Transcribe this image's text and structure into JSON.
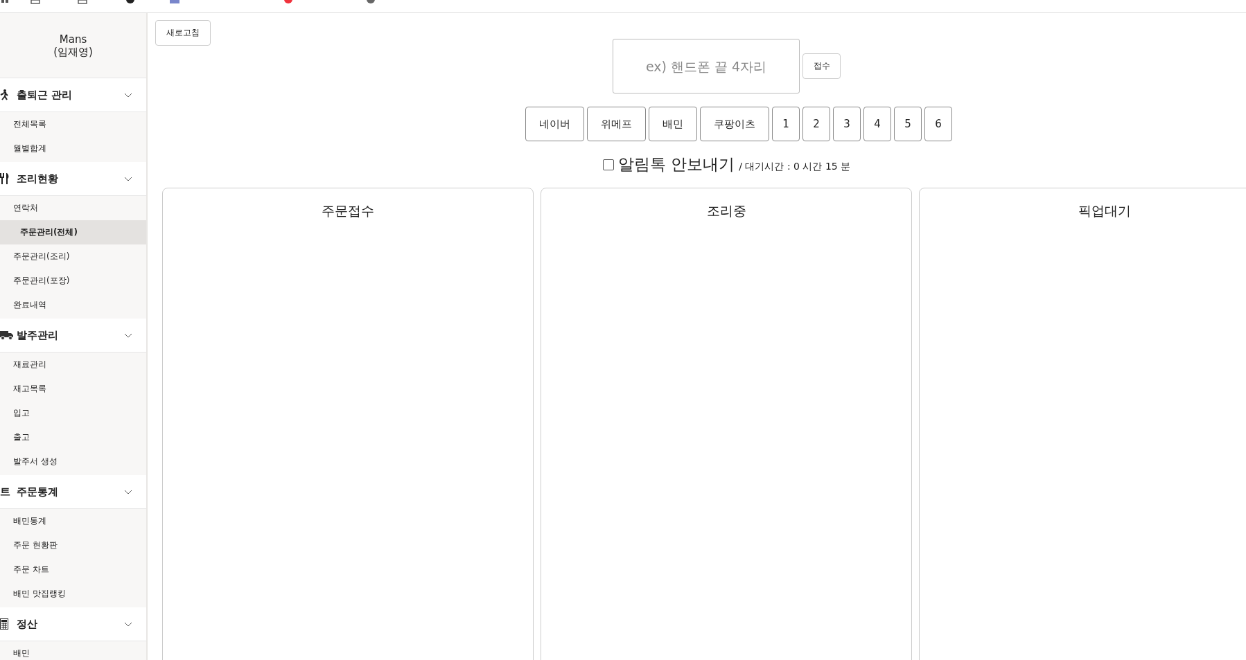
{
  "sidebar": {
    "user": {
      "name": "Mans",
      "real_name": "(임재영)"
    },
    "groups": [
      {
        "kind": "person",
        "title": "출퇴근 관리",
        "items": [
          {
            "label": "전체목록",
            "selected": false
          },
          {
            "label": "월별합계",
            "selected": false
          }
        ]
      },
      {
        "kind": "utensils",
        "title": "조리현황",
        "items": [
          {
            "label": "연락처",
            "selected": false
          },
          {
            "label": "주문관리(전체)",
            "selected": true
          },
          {
            "label": "주문관리(조리)",
            "selected": false
          },
          {
            "label": "주문관리(포장)",
            "selected": false
          },
          {
            "label": "완료내역",
            "selected": false
          }
        ]
      },
      {
        "kind": "truck",
        "title": "발주관리",
        "items": [
          {
            "label": "재료관리",
            "selected": false
          },
          {
            "label": "재고목록",
            "selected": false
          },
          {
            "label": "입고",
            "selected": false
          },
          {
            "label": "출고",
            "selected": false
          },
          {
            "label": "발주서 생성",
            "selected": false
          }
        ]
      },
      {
        "kind": "text",
        "icon_text": "트",
        "title": "주문통계",
        "items": [
          {
            "label": "배민통계",
            "selected": false
          },
          {
            "label": "주문 현황판",
            "selected": false
          },
          {
            "label": "주문 차트",
            "selected": false
          },
          {
            "label": "배민 맛집랭킹",
            "selected": false
          }
        ]
      },
      {
        "kind": "calculator",
        "title": "정산",
        "items": [
          {
            "label": "배민",
            "selected": false
          }
        ]
      }
    ]
  },
  "refresh_button": "새로고침",
  "phone_input": {
    "placeholder": "ex) 핸드폰 끝 4자리"
  },
  "submit_button": "접수",
  "channel_buttons": [
    "네이버",
    "위메프",
    "배민",
    "쿠팡이츠",
    "1",
    "2",
    "3",
    "4",
    "5",
    "6"
  ],
  "notify": {
    "label": "알림톡 안보내기",
    "checked": false,
    "wait_text": "/ 대기시간 : 0 시간 15 분"
  },
  "columns": [
    {
      "title": "주문접수"
    },
    {
      "title": "조리중"
    },
    {
      "title": "픽업대기"
    }
  ]
}
